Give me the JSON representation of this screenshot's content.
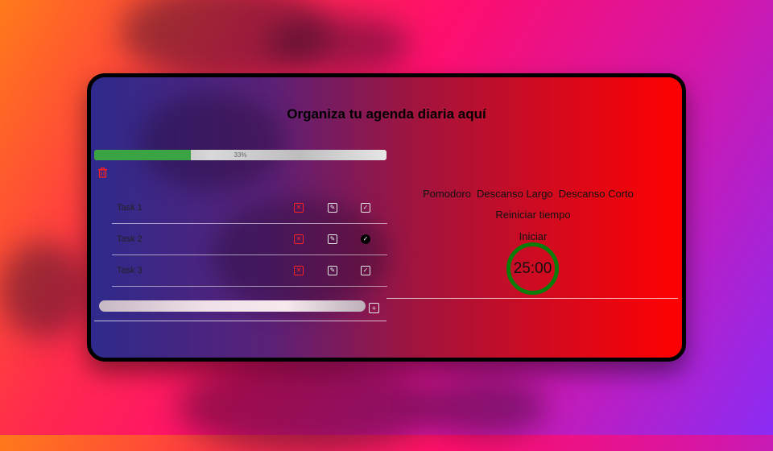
{
  "app": {
    "title": "Organiza tu agenda diaria aquí"
  },
  "progress": {
    "value_fraction": 0.33,
    "label": "33%",
    "fill_color": "#3aa343"
  },
  "toolbar": {
    "delete_all_icon": "trash-icon"
  },
  "tasks": [
    {
      "name": "Task 1",
      "completed": false
    },
    {
      "name": "Task 2",
      "completed": true
    },
    {
      "name": "Task 3",
      "completed": false
    }
  ],
  "task_icons": {
    "delete": "trash-icon",
    "edit": "edit-icon",
    "done": "check-circle-icon"
  },
  "new_task": {
    "value": "",
    "add_icon": "plus-circle-icon"
  },
  "pomodoro": {
    "modes": [
      "Pomodoro",
      "Descanso Largo",
      "Descanso Corto"
    ],
    "reset_label": "Reiniciar tiempo",
    "start_label": "Iniciar",
    "time": "25:00",
    "ring_color": "#0b7d0b"
  },
  "colors": {
    "delete_accent": "#ff2222",
    "panel_gradient_start": "#2e2a8c",
    "panel_gradient_end": "#ff0000"
  }
}
